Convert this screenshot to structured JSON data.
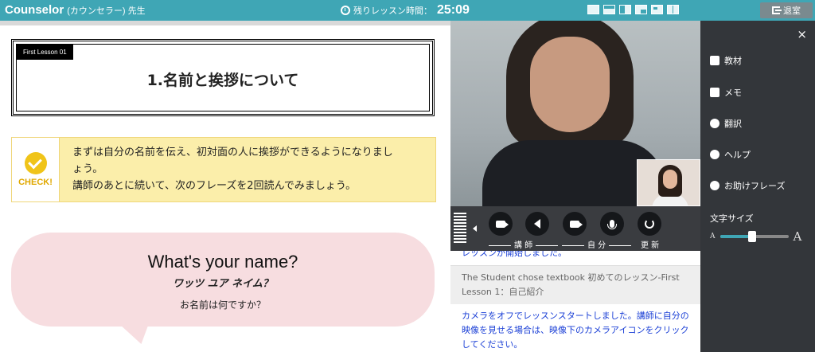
{
  "header": {
    "brand": "Counselor",
    "role": "(カウンセラー) 先生",
    "timer_label": "残りレッスン時間：",
    "timer_value": "25:09",
    "layout_options": [
      "layout-1",
      "layout-2",
      "layout-3",
      "layout-4",
      "layout-5",
      "layout-6"
    ],
    "exit_label": "退室"
  },
  "lesson": {
    "tag": "First Lesson 01",
    "title": "1.名前と挨拶について",
    "check": {
      "badge": "CHECK!",
      "line1": "まずは自分の名前を伝え、初対面の人に挨拶ができるようになりまし",
      "line2": "ょう。",
      "line3": "講師のあとに続いて、次のフレーズを2回読んでみましょう。"
    },
    "phrase": {
      "english": "What's your name?",
      "kana": "ワッツ ユア ネイム？",
      "japanese": "お名前は何ですか？"
    }
  },
  "controls": {
    "teacher_label": "講 師",
    "self_label": "自 分",
    "refresh_label": "更 新"
  },
  "chat": {
    "messages": [
      {
        "text": "レッスンが開始しました。"
      },
      {
        "text": "The Student chose textbook 初めてのレッスン-First Lesson 1：自己紹介"
      },
      {
        "text": "カメラをオフでレッスンスタートしました。講師に自分の映像を見せる場合は、映像下のカメラアイコンをクリックしてください。"
      }
    ]
  },
  "side_menu": {
    "close": "×",
    "items": [
      {
        "label": "教材",
        "icon": "book-icon"
      },
      {
        "label": "メモ",
        "icon": "edit-icon"
      },
      {
        "label": "翻訳",
        "icon": "globe-icon"
      },
      {
        "label": "ヘルプ",
        "icon": "help-icon"
      },
      {
        "label": "お助けフレーズ",
        "icon": "chat-icon"
      }
    ],
    "font_size_label": "文字サイズ",
    "font_small": "A",
    "font_large": "A",
    "font_size_level": 0.47
  },
  "colors": {
    "topbar": "#3fa6b5",
    "side": "#33363a",
    "check_bg": "#fbeeaa",
    "bubble_bg": "#f7dde0",
    "chat_link": "#1a3fd6"
  }
}
